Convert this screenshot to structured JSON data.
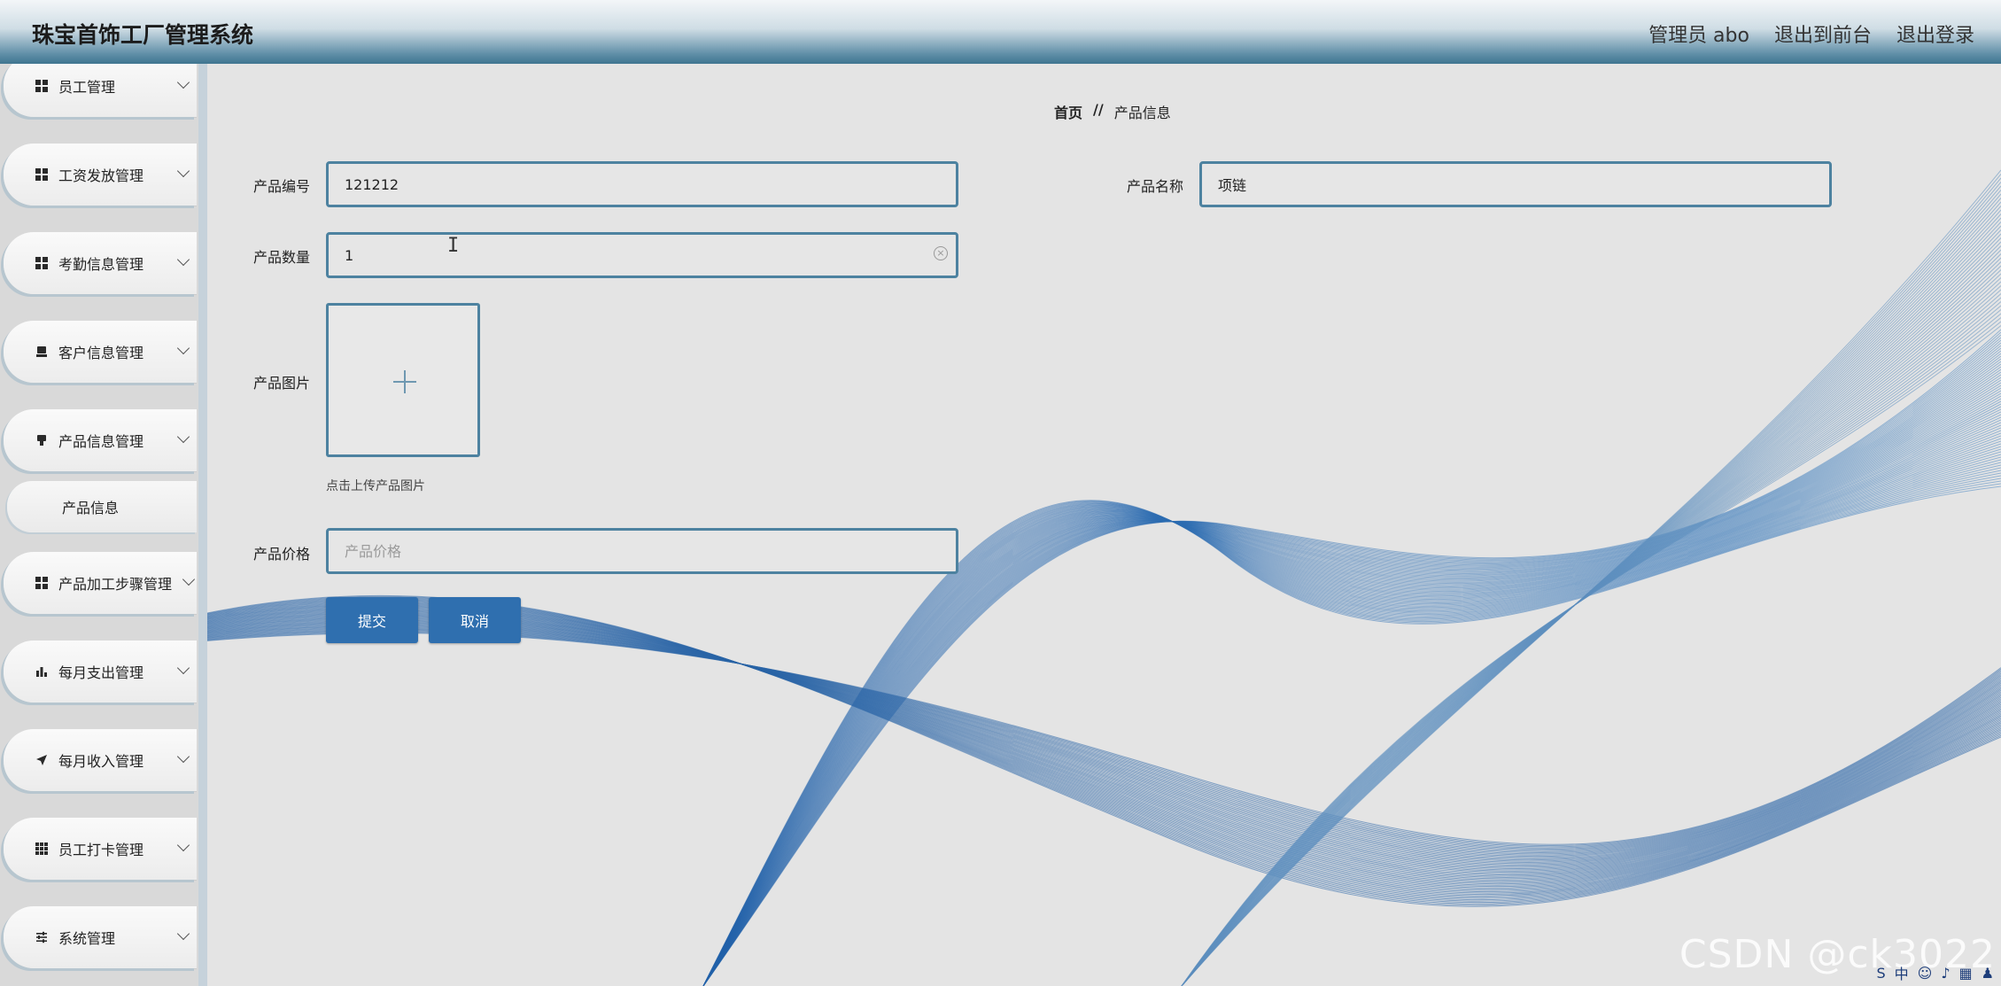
{
  "header": {
    "title": "珠宝首饰工厂管理系统",
    "admin": "管理员 abo",
    "to_front": "退出到前台",
    "logout": "退出登录"
  },
  "sidebar": {
    "items": [
      {
        "label": "员工管理",
        "icon": "grid-icon"
      },
      {
        "label": "工资发放管理",
        "icon": "grid-icon"
      },
      {
        "label": "考勤信息管理",
        "icon": "grid-icon"
      },
      {
        "label": "客户信息管理",
        "icon": "stamp-icon"
      },
      {
        "label": "产品信息管理",
        "icon": "stamp-icon"
      },
      {
        "label": "产品加工步骤管理",
        "icon": "grid-icon"
      },
      {
        "label": "每月支出管理",
        "icon": "bar-chart-icon"
      },
      {
        "label": "每月收入管理",
        "icon": "paper-plane-icon"
      },
      {
        "label": "员工打卡管理",
        "icon": "grid9-icon"
      },
      {
        "label": "系统管理",
        "icon": "sliders-icon"
      }
    ],
    "sub_item": "产品信息"
  },
  "breadcrumb": {
    "home": "首页",
    "sep": "//",
    "current": "产品信息"
  },
  "form": {
    "code_label": "产品编号",
    "code_value": "121212",
    "name_label": "产品名称",
    "name_value": "项链",
    "qty_label": "产品数量",
    "qty_value": "1",
    "image_label": "产品图片",
    "upload_hint": "点击上传产品图片",
    "price_label": "产品价格",
    "price_placeholder": "产品价格",
    "submit": "提交",
    "cancel": "取消"
  },
  "watermark": "CSDN @ck3022",
  "tray": {
    "ime": "中"
  },
  "colors": {
    "accent": "#2f6faf",
    "border": "#4d82a0",
    "wave": "#1f5fa8"
  }
}
